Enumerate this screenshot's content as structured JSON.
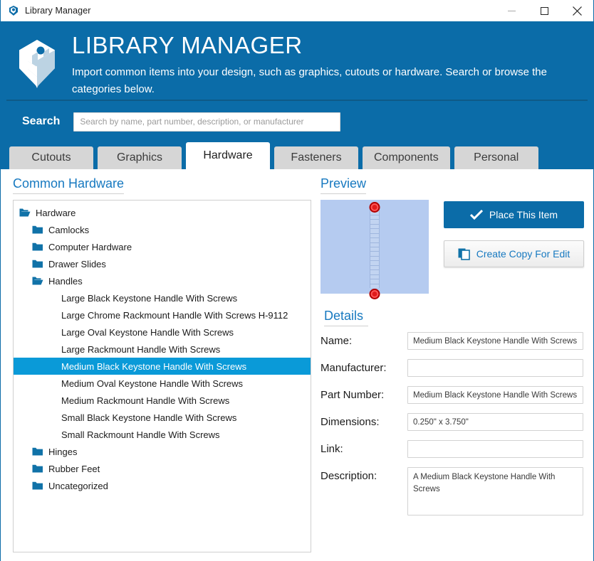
{
  "window": {
    "title": "Library Manager",
    "icon": "app-logo-icon",
    "controls": {
      "minimize": "–",
      "maximize": "□",
      "close": "✕"
    }
  },
  "header": {
    "title": "LIBRARY MANAGER",
    "subtitle": "Import common items into your design, such as graphics, cutouts or hardware. Search or browse the categories below.",
    "brand_color": "#0b6ca8",
    "logo_icon": "isometric-p-logo-icon"
  },
  "search": {
    "label": "Search",
    "placeholder": "Search by name, part number, description, or manufacturer",
    "value": ""
  },
  "tabs": [
    {
      "label": "Cutouts",
      "active": false
    },
    {
      "label": "Graphics",
      "active": false
    },
    {
      "label": "Hardware",
      "active": true
    },
    {
      "label": "Fasteners",
      "active": false
    },
    {
      "label": "Components",
      "active": false
    },
    {
      "label": "Personal",
      "active": false
    }
  ],
  "tree_panel": {
    "heading": "Common Hardware",
    "items": [
      {
        "label": "Hardware",
        "depth": 0,
        "type": "folder-open",
        "selected": false
      },
      {
        "label": "Camlocks",
        "depth": 1,
        "type": "folder-closed",
        "selected": false
      },
      {
        "label": "Computer Hardware",
        "depth": 1,
        "type": "folder-closed",
        "selected": false
      },
      {
        "label": "Drawer Slides",
        "depth": 1,
        "type": "folder-closed",
        "selected": false
      },
      {
        "label": "Handles",
        "depth": 1,
        "type": "folder-open",
        "selected": false
      },
      {
        "label": "Large Black Keystone Handle With Screws",
        "depth": 2,
        "type": "leaf",
        "selected": false
      },
      {
        "label": "Large Chrome Rackmount Handle With Screws H-9112",
        "depth": 2,
        "type": "leaf",
        "selected": false
      },
      {
        "label": "Large Oval Keystone Handle With Screws",
        "depth": 2,
        "type": "leaf",
        "selected": false
      },
      {
        "label": "Large Rackmount Handle With Screws",
        "depth": 2,
        "type": "leaf",
        "selected": false
      },
      {
        "label": "Medium Black Keystone Handle With Screws",
        "depth": 2,
        "type": "leaf",
        "selected": true
      },
      {
        "label": "Medium Oval Keystone Handle With Screws",
        "depth": 2,
        "type": "leaf",
        "selected": false
      },
      {
        "label": "Medium Rackmount Handle With Screws",
        "depth": 2,
        "type": "leaf",
        "selected": false
      },
      {
        "label": "Small Black Keystone Handle With Screws",
        "depth": 2,
        "type": "leaf",
        "selected": false
      },
      {
        "label": "Small Rackmount Handle With Screws",
        "depth": 2,
        "type": "leaf",
        "selected": false
      },
      {
        "label": "Hinges",
        "depth": 1,
        "type": "folder-closed",
        "selected": false
      },
      {
        "label": "Rubber Feet",
        "depth": 1,
        "type": "folder-closed",
        "selected": false
      },
      {
        "label": "Uncategorized",
        "depth": 1,
        "type": "folder-closed",
        "selected": false
      }
    ],
    "selection_color": "#0a9ad8",
    "folder_color": "#1072a8"
  },
  "preview": {
    "heading": "Preview",
    "canvas_background": "#b5cbf0",
    "part_color": "#c2d4f1",
    "screw_color": "#e01b1b",
    "rung_count": 18
  },
  "actions": {
    "place_label": "Place This Item",
    "place_icon": "check-icon",
    "copy_label": "Create Copy For Edit",
    "copy_icon": "copy-icon"
  },
  "details": {
    "heading": "Details",
    "fields": [
      {
        "label": "Name:",
        "value": "Medium Black Keystone Handle With Screws",
        "type": "text"
      },
      {
        "label": "Manufacturer:",
        "value": "",
        "type": "text"
      },
      {
        "label": "Part Number:",
        "value": "Medium Black Keystone Handle With Screws",
        "type": "text"
      },
      {
        "label": "Dimensions:",
        "value": "0.250\" x 3.750\"",
        "type": "text"
      },
      {
        "label": "Link:",
        "value": "",
        "type": "text"
      },
      {
        "label": "Description:",
        "value": "A Medium Black Keystone Handle With Screws",
        "type": "textarea"
      }
    ]
  }
}
